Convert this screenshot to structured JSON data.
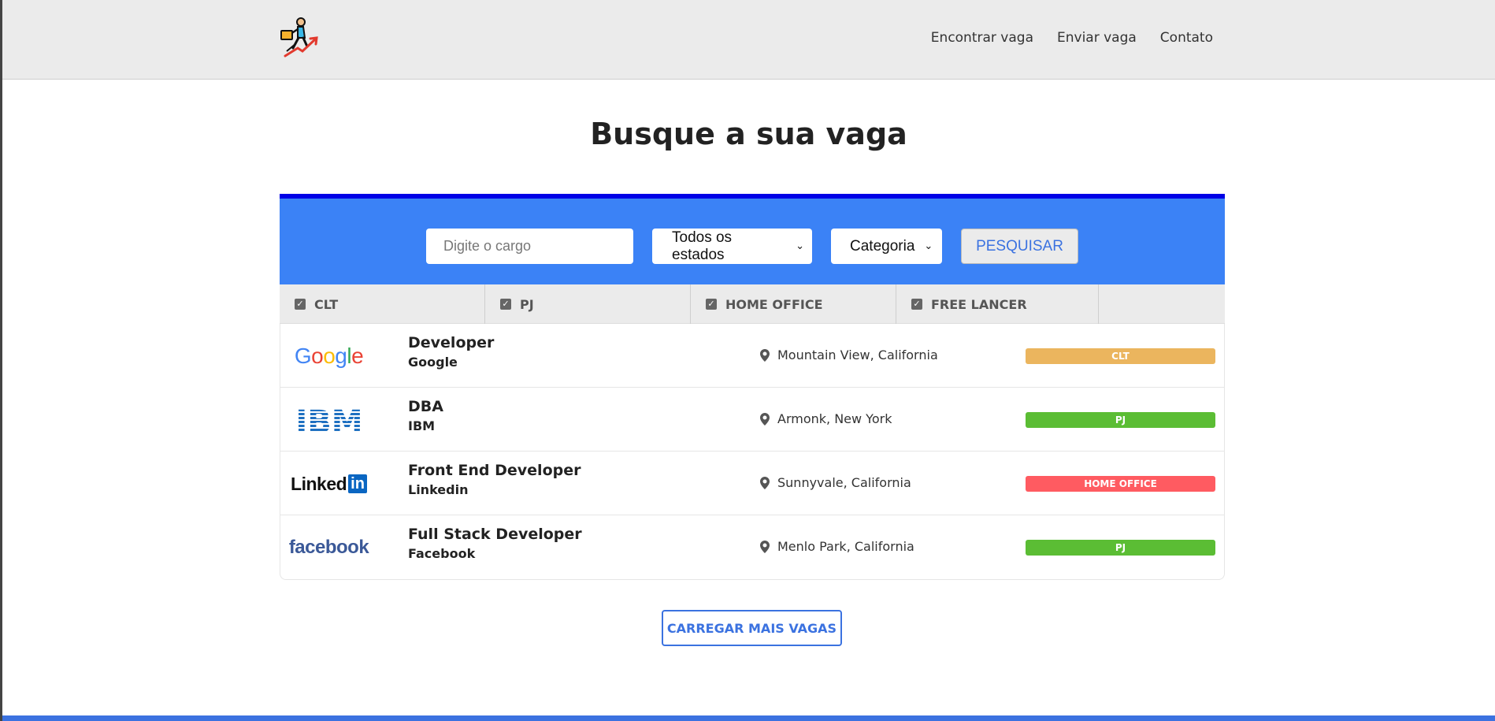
{
  "header": {
    "logo_icon": "running-businessman-growth-icon",
    "nav": [
      "Encontrar vaga",
      "Enviar vaga",
      "Contato"
    ]
  },
  "main": {
    "title": "Busque a sua vaga"
  },
  "search": {
    "cargo_placeholder": "Digite o cargo",
    "estado_selected": "Todos os estados",
    "categoria_selected": "Categoria",
    "button_label": "PESQUISAR"
  },
  "filters": [
    "CLT",
    "PJ",
    "HOME OFFICE",
    "FREE LANCER"
  ],
  "jobs": [
    {
      "title": "Developer",
      "company": "Google",
      "location": "Mountain View, California",
      "type": "CLT",
      "type_color": "#ebb55e",
      "logo": "Google"
    },
    {
      "title": "DBA",
      "company": "IBM",
      "location": "Armonk, New York",
      "type": "PJ",
      "type_color": "#5bbd34",
      "logo": "IBM"
    },
    {
      "title": "Front End Developer",
      "company": "Linkedin",
      "location": "Sunnyvale, California",
      "type": "HOME OFFICE",
      "type_color": "#ff5b61",
      "logo": "Linked in"
    },
    {
      "title": "Full Stack Developer",
      "company": "Facebook",
      "location": "Menlo Park, California",
      "type": "PJ",
      "type_color": "#5bbd34",
      "logo": "facebook"
    }
  ],
  "load_more_label": "CARREGAR MAIS VAGAS",
  "colors": {
    "accent": "#3b82f6",
    "accent_top": "#0000e6",
    "link": "#3b72e0"
  }
}
